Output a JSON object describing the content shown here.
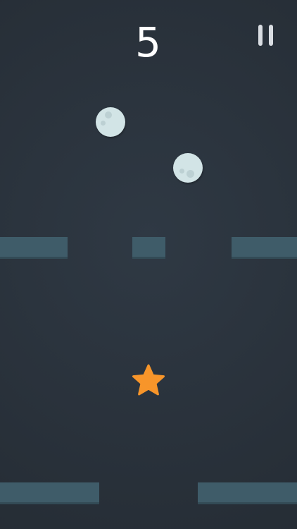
{
  "hud": {
    "score": "5",
    "pause_icon": "pause-icon"
  },
  "colors": {
    "background": "#283039",
    "bar": "#3f5c69",
    "ball": "#d2e4e6",
    "star": "#f7952a",
    "text": "#ffffff"
  },
  "items": {
    "collectible_icon": "star-icon",
    "ball_icon": "moon-ball-icon"
  }
}
